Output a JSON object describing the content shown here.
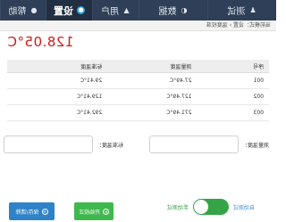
{
  "nav": {
    "items": [
      {
        "label": "测试",
        "icon": "user-icon",
        "glyph": "♟"
      },
      {
        "label": "数据",
        "icon": "chart-icon",
        "glyph": "◐"
      },
      {
        "label": "用户",
        "icon": "person-icon",
        "glyph": "▲"
      },
      {
        "label": "设置",
        "icon": "gear-icon",
        "glyph": "●",
        "active": true
      },
      {
        "label": "帮助",
        "icon": "help-icon",
        "glyph": "●"
      }
    ]
  },
  "breadcrumb": "当前模式：设置 › 温度校准",
  "temperature": "128.05°C",
  "table": {
    "headers": [
      "序号",
      "测量温度",
      "标准温度"
    ],
    "rows": [
      [
        "001",
        "27.49°C",
        "29.41°C"
      ],
      [
        "002",
        "127.49°C",
        "129.41°C"
      ],
      [
        "003",
        "271.49°C",
        "292.41°C"
      ]
    ]
  },
  "fields": {
    "measured_label": "测量温度：",
    "standard_label": "标准温度："
  },
  "mode": {
    "auto_label": "自动测试",
    "manual_label": "手动测试",
    "manual_on": true
  },
  "buttons": {
    "start": "开始校正",
    "save": "保存/清除"
  },
  "colors": {
    "nav_bg": "#2f3f57",
    "active_bg": "#222f42",
    "temp_red": "#d11a1a",
    "green": "#35a447",
    "blue": "#2d82c8"
  }
}
